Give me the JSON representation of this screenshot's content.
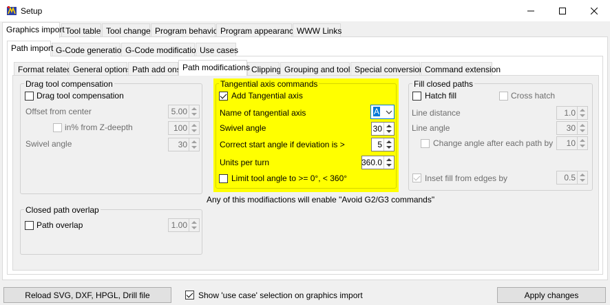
{
  "window": {
    "title": "Setup",
    "icon": "app-icon"
  },
  "tabs_l1": [
    "Graphics import",
    "Tool table",
    "Tool change",
    "Program behavior",
    "Program appearance",
    "WWW Links"
  ],
  "tabs_l2": [
    "Path import",
    "G-Code generation",
    "G-Code modification",
    "Use cases"
  ],
  "tabs_l3": [
    "Format related",
    "General options",
    "Path add ons",
    "Path modifications",
    "Clipping",
    "Grouping and tools",
    "Special conversion",
    "Command extension"
  ],
  "drag": {
    "title": "Drag tool compensation",
    "enable_label": "Drag tool compensation",
    "offset_label": "Offset from center",
    "offset_value": "5.00",
    "percent_label": "in% from Z-deepth",
    "percent_value": "100",
    "swivel_label": "Swivel angle",
    "swivel_value": "30"
  },
  "overlap": {
    "title": "Closed path overlap",
    "enable_label": "Path overlap",
    "value": "1.00"
  },
  "tangential": {
    "title": "Tangential axis commands",
    "enable_label": "Add Tangential axis",
    "name_label": "Name of tangential axis",
    "name_value": "A",
    "swivel_label": "Swivel angle",
    "swivel_value": "30",
    "correct_label": "Correct start angle if deviation is >",
    "correct_value": "5",
    "units_label": "Units per turn",
    "units_value": "360.0",
    "limit_label": "Limit tool angle to >= 0°, < 360°",
    "highlight_color": "#ffff00"
  },
  "note": "Any of this modifiactions will enable \"Avoid G2/G3 commands\"",
  "fill": {
    "title": "Fill closed paths",
    "hatch_label": "Hatch fill",
    "cross_label": "Cross hatch",
    "distance_label": "Line distance",
    "distance_value": "1.0",
    "angle_label": "Line angle",
    "angle_value": "30",
    "change_label": "Change angle after each path by",
    "change_value": "10",
    "inset_label": "Inset fill from edges by",
    "inset_value": "0.5"
  },
  "bottom": {
    "reload_label": "Reload SVG, DXF, HPGL, Drill file",
    "show_label": "Show 'use case' selection on graphics import",
    "apply_label": "Apply changes"
  }
}
